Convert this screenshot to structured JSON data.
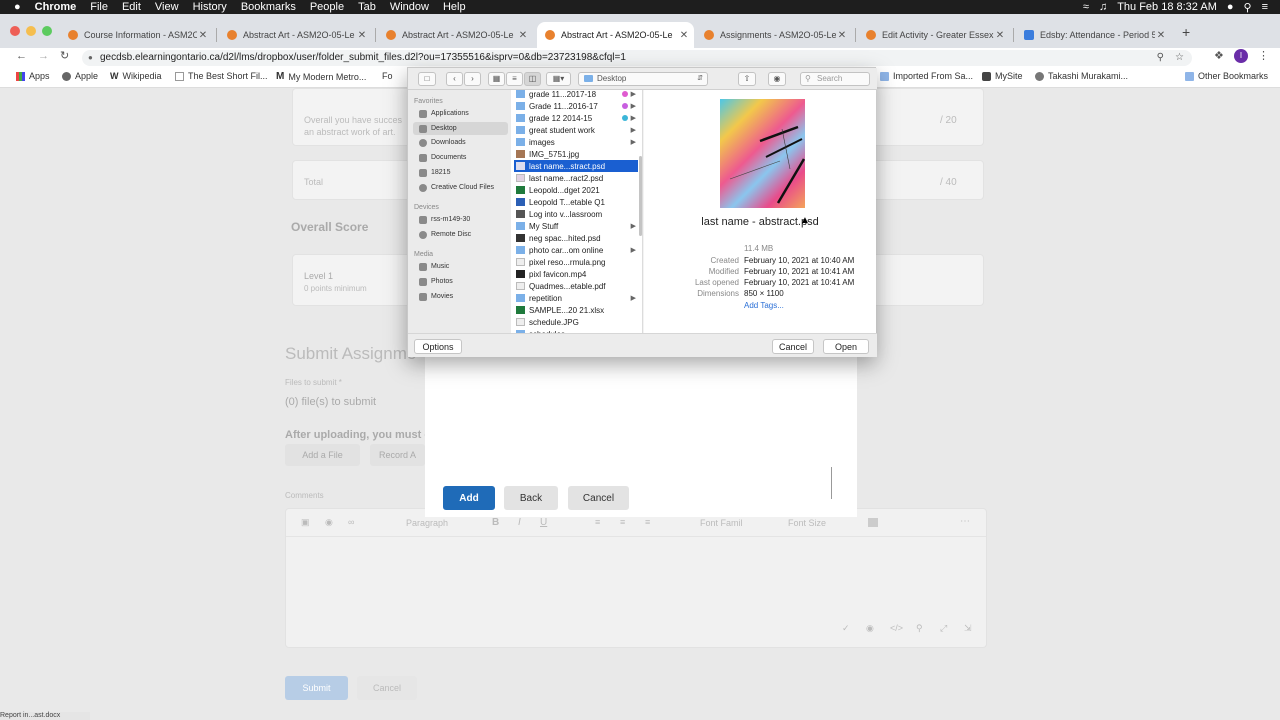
{
  "menubar": {
    "apple": "",
    "app": "Chrome",
    "items": [
      "File",
      "Edit",
      "View",
      "History",
      "Bookmarks",
      "People",
      "Tab",
      "Window",
      "Help"
    ],
    "datetime": "Thu Feb 18  8:32 AM"
  },
  "tabs": [
    {
      "title": "Course Information - ASM2O"
    },
    {
      "title": "Abstract Art - ASM2O-05-Le"
    },
    {
      "title": "Abstract Art - ASM2O-05-Le"
    },
    {
      "title": "Abstract Art - ASM2O-05-Le"
    },
    {
      "title": "Assignments - ASM2O-05-Le"
    },
    {
      "title": "Edit Activity - Greater Essex C"
    },
    {
      "title": "Edsby: Attendance - Period 5"
    }
  ],
  "toolbar": {
    "url": "gecdsb.elearningontario.ca/d2l/lms/dropbox/user/folder_submit_files.d2l?ou=17355516&isprv=0&db=23723198&cfql=1"
  },
  "bookmarks": [
    {
      "label": "Apps"
    },
    {
      "label": "Apple"
    },
    {
      "label": "Wikipedia"
    },
    {
      "label": "The Best Short Fil..."
    },
    {
      "label": "My Modern Metro..."
    },
    {
      "label": "Fo"
    },
    {
      "label": "Imported From Sa..."
    },
    {
      "label": "MySite"
    },
    {
      "label": "Takashi Murakami..."
    },
    {
      "label": "Other Bookmarks"
    }
  ],
  "page": {
    "overall_text": "Overall you have succes\nan abstract work of art.",
    "score20": "/ 20",
    "total_label": "Total",
    "score40": "/ 40",
    "overall_score": "Overall Score",
    "level1": "Level 1",
    "level1_sub": "0 points minimum",
    "submit_title": "Submit Assignme",
    "files_label": "Files to submit *",
    "files_count": "(0) file(s) to submit",
    "after_uploading": "After uploading, you must c",
    "add_file": "Add a File",
    "record_audio": "Record A",
    "comments": "Comments",
    "editor_paragraph": "Paragraph",
    "editor_font": "Font Famil",
    "editor_size": "Font Size",
    "submit_btn": "Submit",
    "cancel_btn": "Cancel"
  },
  "modal": {
    "add": "Add",
    "back": "Back",
    "cancel": "Cancel"
  },
  "dialog": {
    "location": "Desktop",
    "search_placeholder": "Search",
    "favorites_header": "Favorites",
    "favorites": [
      "Applications",
      "Desktop",
      "Downloads",
      "Documents",
      "18215",
      "Creative Cloud Files"
    ],
    "devices_header": "Devices",
    "devices": [
      "rss-m149-30",
      "Remote Disc"
    ],
    "media_header": "Media",
    "media": [
      "Music",
      "Photos",
      "Movies"
    ],
    "files": [
      {
        "name": "grade 11...2017-18"
      },
      {
        "name": "Grade 11...2016-17"
      },
      {
        "name": "grade 12 2014-15"
      },
      {
        "name": "great student work"
      },
      {
        "name": "images"
      },
      {
        "name": "IMG_5751.jpg"
      },
      {
        "name": "last name...stract.psd"
      },
      {
        "name": "last name...ract2.psd"
      },
      {
        "name": "Leopold...dget 2021"
      },
      {
        "name": "Leopold T...etable Q1"
      },
      {
        "name": "Log into v...lassroom"
      },
      {
        "name": "My Stuff"
      },
      {
        "name": "neg spac...hited.psd"
      },
      {
        "name": "photo car...om online"
      },
      {
        "name": "pixel reso...rmula.png"
      },
      {
        "name": "pixl favicon.mp4"
      },
      {
        "name": "Quadmes...etable.pdf"
      },
      {
        "name": "repetition"
      },
      {
        "name": "SAMPLE...20 21.xlsx"
      },
      {
        "name": "schedule.JPG"
      },
      {
        "name": "schedules"
      }
    ],
    "preview": {
      "filename": "last name - abstract.psd",
      "size": "11.4 MB",
      "created_label": "Created",
      "created": "February 10, 2021 at 10:40 AM",
      "modified_label": "Modified",
      "modified": "February 10, 2021 at 10:41 AM",
      "opened_label": "Last opened",
      "opened": "February 10, 2021 at 10:41 AM",
      "dimensions_label": "Dimensions",
      "dimensions": "850 × 1100",
      "add_tags": "Add Tags..."
    },
    "options": "Options",
    "cancel": "Cancel",
    "open": "Open"
  },
  "statusbar": "Report in...ast.docx"
}
